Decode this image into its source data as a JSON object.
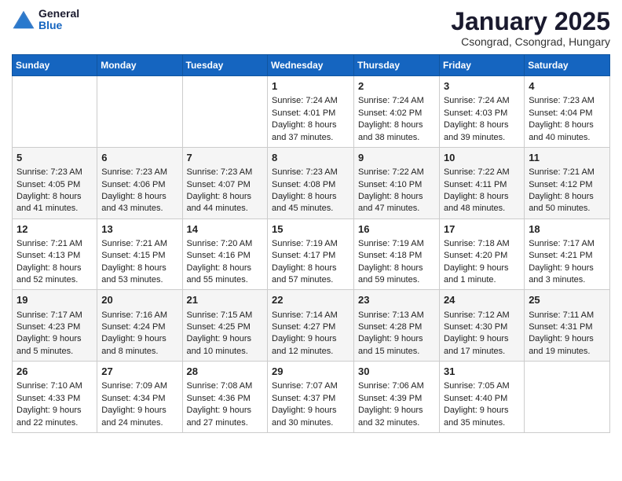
{
  "header": {
    "logo_general": "General",
    "logo_blue": "Blue",
    "month_title": "January 2025",
    "location": "Csongrad, Csongrad, Hungary"
  },
  "calendar": {
    "days_of_week": [
      "Sunday",
      "Monday",
      "Tuesday",
      "Wednesday",
      "Thursday",
      "Friday",
      "Saturday"
    ],
    "weeks": [
      [
        {
          "day": "",
          "content": ""
        },
        {
          "day": "",
          "content": ""
        },
        {
          "day": "",
          "content": ""
        },
        {
          "day": "1",
          "content": "Sunrise: 7:24 AM\nSunset: 4:01 PM\nDaylight: 8 hours and 37 minutes."
        },
        {
          "day": "2",
          "content": "Sunrise: 7:24 AM\nSunset: 4:02 PM\nDaylight: 8 hours and 38 minutes."
        },
        {
          "day": "3",
          "content": "Sunrise: 7:24 AM\nSunset: 4:03 PM\nDaylight: 8 hours and 39 minutes."
        },
        {
          "day": "4",
          "content": "Sunrise: 7:23 AM\nSunset: 4:04 PM\nDaylight: 8 hours and 40 minutes."
        }
      ],
      [
        {
          "day": "5",
          "content": "Sunrise: 7:23 AM\nSunset: 4:05 PM\nDaylight: 8 hours and 41 minutes."
        },
        {
          "day": "6",
          "content": "Sunrise: 7:23 AM\nSunset: 4:06 PM\nDaylight: 8 hours and 43 minutes."
        },
        {
          "day": "7",
          "content": "Sunrise: 7:23 AM\nSunset: 4:07 PM\nDaylight: 8 hours and 44 minutes."
        },
        {
          "day": "8",
          "content": "Sunrise: 7:23 AM\nSunset: 4:08 PM\nDaylight: 8 hours and 45 minutes."
        },
        {
          "day": "9",
          "content": "Sunrise: 7:22 AM\nSunset: 4:10 PM\nDaylight: 8 hours and 47 minutes."
        },
        {
          "day": "10",
          "content": "Sunrise: 7:22 AM\nSunset: 4:11 PM\nDaylight: 8 hours and 48 minutes."
        },
        {
          "day": "11",
          "content": "Sunrise: 7:21 AM\nSunset: 4:12 PM\nDaylight: 8 hours and 50 minutes."
        }
      ],
      [
        {
          "day": "12",
          "content": "Sunrise: 7:21 AM\nSunset: 4:13 PM\nDaylight: 8 hours and 52 minutes."
        },
        {
          "day": "13",
          "content": "Sunrise: 7:21 AM\nSunset: 4:15 PM\nDaylight: 8 hours and 53 minutes."
        },
        {
          "day": "14",
          "content": "Sunrise: 7:20 AM\nSunset: 4:16 PM\nDaylight: 8 hours and 55 minutes."
        },
        {
          "day": "15",
          "content": "Sunrise: 7:19 AM\nSunset: 4:17 PM\nDaylight: 8 hours and 57 minutes."
        },
        {
          "day": "16",
          "content": "Sunrise: 7:19 AM\nSunset: 4:18 PM\nDaylight: 8 hours and 59 minutes."
        },
        {
          "day": "17",
          "content": "Sunrise: 7:18 AM\nSunset: 4:20 PM\nDaylight: 9 hours and 1 minute."
        },
        {
          "day": "18",
          "content": "Sunrise: 7:17 AM\nSunset: 4:21 PM\nDaylight: 9 hours and 3 minutes."
        }
      ],
      [
        {
          "day": "19",
          "content": "Sunrise: 7:17 AM\nSunset: 4:23 PM\nDaylight: 9 hours and 5 minutes."
        },
        {
          "day": "20",
          "content": "Sunrise: 7:16 AM\nSunset: 4:24 PM\nDaylight: 9 hours and 8 minutes."
        },
        {
          "day": "21",
          "content": "Sunrise: 7:15 AM\nSunset: 4:25 PM\nDaylight: 9 hours and 10 minutes."
        },
        {
          "day": "22",
          "content": "Sunrise: 7:14 AM\nSunset: 4:27 PM\nDaylight: 9 hours and 12 minutes."
        },
        {
          "day": "23",
          "content": "Sunrise: 7:13 AM\nSunset: 4:28 PM\nDaylight: 9 hours and 15 minutes."
        },
        {
          "day": "24",
          "content": "Sunrise: 7:12 AM\nSunset: 4:30 PM\nDaylight: 9 hours and 17 minutes."
        },
        {
          "day": "25",
          "content": "Sunrise: 7:11 AM\nSunset: 4:31 PM\nDaylight: 9 hours and 19 minutes."
        }
      ],
      [
        {
          "day": "26",
          "content": "Sunrise: 7:10 AM\nSunset: 4:33 PM\nDaylight: 9 hours and 22 minutes."
        },
        {
          "day": "27",
          "content": "Sunrise: 7:09 AM\nSunset: 4:34 PM\nDaylight: 9 hours and 24 minutes."
        },
        {
          "day": "28",
          "content": "Sunrise: 7:08 AM\nSunset: 4:36 PM\nDaylight: 9 hours and 27 minutes."
        },
        {
          "day": "29",
          "content": "Sunrise: 7:07 AM\nSunset: 4:37 PM\nDaylight: 9 hours and 30 minutes."
        },
        {
          "day": "30",
          "content": "Sunrise: 7:06 AM\nSunset: 4:39 PM\nDaylight: 9 hours and 32 minutes."
        },
        {
          "day": "31",
          "content": "Sunrise: 7:05 AM\nSunset: 4:40 PM\nDaylight: 9 hours and 35 minutes."
        },
        {
          "day": "",
          "content": ""
        }
      ]
    ]
  }
}
